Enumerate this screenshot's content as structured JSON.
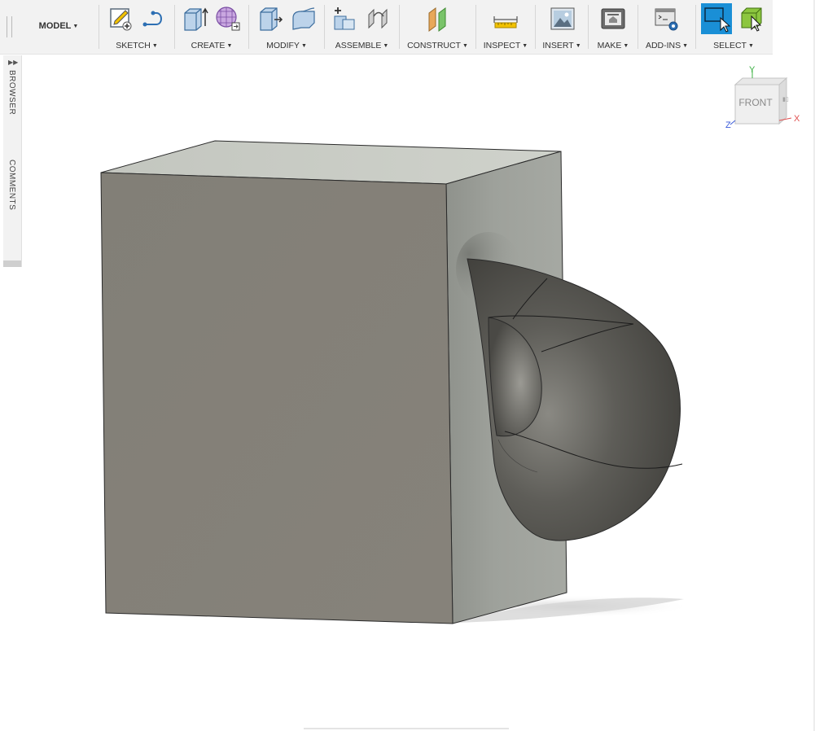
{
  "toolbar": {
    "workspace_label": "MODEL",
    "groups": [
      {
        "label": "SKETCH"
      },
      {
        "label": "CREATE"
      },
      {
        "label": "MODIFY"
      },
      {
        "label": "ASSEMBLE"
      },
      {
        "label": "CONSTRUCT"
      },
      {
        "label": "INSPECT"
      },
      {
        "label": "INSERT"
      },
      {
        "label": "MAKE"
      },
      {
        "label": "ADD-INS"
      },
      {
        "label": "SELECT"
      }
    ]
  },
  "sidebar": {
    "tabs": [
      {
        "label": "BROWSER"
      },
      {
        "label": "COMMENTS"
      }
    ]
  },
  "viewcube": {
    "face_label": "FRONT",
    "axis_x": "X",
    "axis_y": "Y",
    "axis_z": "Z"
  },
  "colors": {
    "toolbar_bg": "#f2f2f2",
    "select_accent": "#1a8fd6",
    "axis_x": "#e05050",
    "axis_y": "#3cb043",
    "axis_z": "#3a5bd9"
  }
}
